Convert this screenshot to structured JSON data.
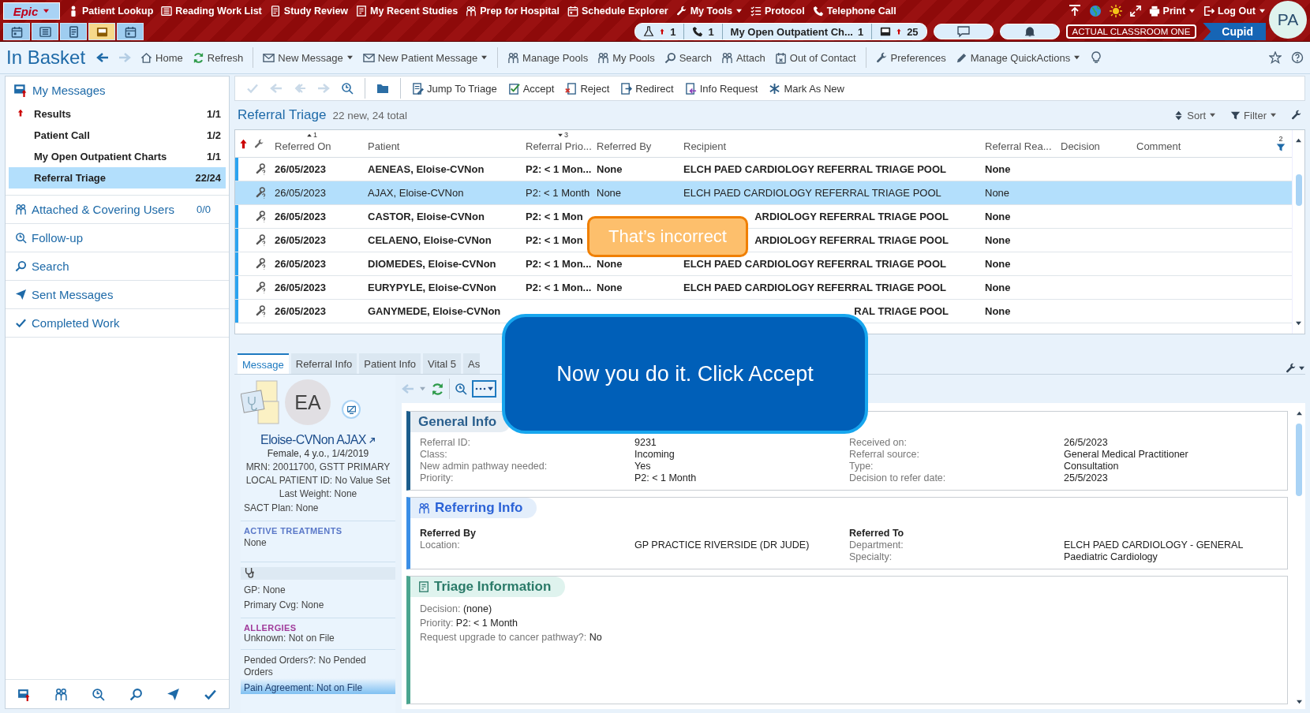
{
  "top_menu": {
    "logo": "Epic",
    "logo_dropdown": true,
    "items": [
      {
        "label": "Patient Lookup",
        "dropdown": false
      },
      {
        "label": "Reading Work List",
        "dropdown": false
      },
      {
        "label": "Study Review",
        "dropdown": false
      },
      {
        "label": "My Recent Studies",
        "dropdown": false
      },
      {
        "label": "Prep for Hospital",
        "dropdown": false
      },
      {
        "label": "Schedule Explorer",
        "dropdown": false
      },
      {
        "label": "My Tools",
        "dropdown": true
      },
      {
        "label": "Protocol",
        "dropdown": false
      },
      {
        "label": "Telephone Call",
        "dropdown": false
      }
    ],
    "right_items": [
      {
        "label": "Print",
        "dropdown": true
      },
      {
        "label": "Log Out",
        "dropdown": true
      }
    ]
  },
  "activity_tabs": [
    {
      "selected": false
    },
    {
      "selected": false
    },
    {
      "selected": false
    },
    {
      "selected": true
    },
    {
      "selected": false
    }
  ],
  "status_pills": [
    {
      "count": "1",
      "alert": true
    },
    {
      "count": "1",
      "alert": false
    },
    {
      "label": "My Open Outpatient Ch...",
      "count": "1",
      "alert": false
    },
    {
      "count": "25",
      "alert": true
    }
  ],
  "environment": "ACTUAL CLASSROOM ONE",
  "user_tag": "Cupid",
  "avatar": "PA",
  "inbasket_toolbar": {
    "title": "In Basket",
    "items": [
      {
        "label": "Home",
        "dropdown": false,
        "group_start": false
      },
      {
        "label": "Refresh",
        "dropdown": false,
        "group_start": false
      },
      {
        "label": "New Message",
        "dropdown": true,
        "group_start": true
      },
      {
        "label": "New Patient Message",
        "dropdown": true,
        "group_start": false
      },
      {
        "label": "Manage Pools",
        "dropdown": false,
        "group_start": true
      },
      {
        "label": "My Pools",
        "dropdown": false,
        "group_start": false
      },
      {
        "label": "Search",
        "dropdown": false,
        "group_start": false
      },
      {
        "label": "Attach",
        "dropdown": false,
        "group_start": false
      },
      {
        "label": "Out of Contact",
        "dropdown": false,
        "group_start": false
      },
      {
        "label": "Preferences",
        "dropdown": false,
        "group_start": true
      },
      {
        "label": "Manage QuickActions",
        "dropdown": true,
        "group_start": false
      }
    ]
  },
  "action_toolbar": {
    "icon_buttons": [
      {
        "disabled": true
      },
      {
        "disabled": true
      },
      {
        "disabled": true
      },
      {
        "disabled": true
      },
      {
        "disabled": false
      },
      {
        "disabled": false
      }
    ],
    "items": [
      {
        "label": "Jump To Triage",
        "disabled": false
      },
      {
        "label": "Accept",
        "disabled": false
      },
      {
        "label": "Reject",
        "disabled": false
      },
      {
        "label": "Redirect",
        "disabled": false
      },
      {
        "label": "Info Request",
        "disabled": false
      },
      {
        "label": "Mark As New",
        "disabled": false
      }
    ]
  },
  "sidebar": {
    "header": "My Messages",
    "folders": [
      {
        "label": "Results",
        "count": "1/1",
        "alert": true,
        "selected": false
      },
      {
        "label": "Patient Call",
        "count": "1/2",
        "alert": false,
        "selected": false
      },
      {
        "label": "My Open Outpatient Charts",
        "count": "1/1",
        "alert": false,
        "selected": false
      },
      {
        "label": "Referral Triage",
        "count": "22/24",
        "alert": false,
        "selected": true
      }
    ],
    "links": [
      {
        "label": "Attached & Covering Users",
        "count": "0/0"
      },
      {
        "label": "Follow-up"
      },
      {
        "label": "Search"
      },
      {
        "label": "Sent Messages"
      },
      {
        "label": "Completed Work"
      }
    ]
  },
  "list": {
    "title": "Referral Triage",
    "summary": "22 new, 24 total",
    "sort": "Sort",
    "filter": "Filter",
    "filter_count": "2",
    "columns": [
      {
        "label": "Referred On",
        "sort_order": "1",
        "sort_descending": false
      },
      {
        "label": "Patient"
      },
      {
        "label": "Referral Prio...",
        "sort_order": "3",
        "sort_descending": true
      },
      {
        "label": "Referred By"
      },
      {
        "label": "Recipient"
      },
      {
        "label": "Referral Rea..."
      },
      {
        "label": "Decision"
      },
      {
        "label": "Comment"
      }
    ],
    "rows": [
      {
        "unread": true,
        "selected": false,
        "referred_on": "26/05/2023",
        "patient": "AENEAS, Eloise-CVNon",
        "priority": "P2: < 1 Mon...",
        "referred_by": "None",
        "recipient": "ELCH PAED CARDIOLOGY REFERRAL TRIAGE POOL",
        "reason": "None"
      },
      {
        "unread": false,
        "selected": true,
        "referred_on": "26/05/2023",
        "patient": "AJAX, Eloise-CVNon",
        "priority": "P2: < 1 Month",
        "referred_by": "None",
        "recipient": "ELCH PAED CARDIOLOGY REFERRAL TRIAGE POOL",
        "reason": "None"
      },
      {
        "unread": true,
        "selected": false,
        "referred_on": "26/05/2023",
        "patient": "CASTOR, Eloise-CVNon",
        "priority": "P2: < 1 Mon",
        "recipient_tail": "ARDIOLOGY REFERRAL TRIAGE POOL",
        "reason": "None"
      },
      {
        "unread": true,
        "selected": false,
        "referred_on": "26/05/2023",
        "patient": "CELAENO, Eloise-CVNon",
        "priority": "P2: < 1 Mon",
        "recipient_tail": "ARDIOLOGY REFERRAL TRIAGE POOL",
        "reason": "None"
      },
      {
        "unread": true,
        "selected": false,
        "referred_on": "26/05/2023",
        "patient": "DIOMEDES, Eloise-CVNon",
        "priority": "P2: < 1 Mon...",
        "referred_by": "None",
        "recipient": "ELCH PAED CARDIOLOGY REFERRAL TRIAGE POOL",
        "reason": "None"
      },
      {
        "unread": true,
        "selected": false,
        "referred_on": "26/05/2023",
        "patient": "EURYPYLE, Eloise-CVNon",
        "priority": "P2: < 1 Mon...",
        "referred_by": "None",
        "recipient": "ELCH PAED CARDIOLOGY REFERRAL TRIAGE POOL",
        "reason": "None"
      },
      {
        "unread": true,
        "selected": false,
        "referred_on": "26/05/2023",
        "patient": "GANYMEDE, Eloise-CVNon",
        "recipient_tail": "RAL TRIAGE POOL",
        "reason": "None"
      }
    ]
  },
  "detail_tabs": [
    {
      "label": "Message",
      "selected": true
    },
    {
      "label": "Referral Info",
      "selected": false
    },
    {
      "label": "Patient Info",
      "selected": false
    },
    {
      "label": "Vital 5",
      "selected": false
    },
    {
      "label": "As",
      "selected": false
    }
  ],
  "patient": {
    "initials": "EA",
    "name": "Eloise-CVNon AJAX",
    "demographics": "Female, 4 y.o., 1/4/2019",
    "ids": [
      "MRN: 20011700, GSTT PRIMARY",
      "LOCAL PATIENT ID: No Value Set"
    ],
    "last_weight": "Last Weight: None",
    "sact": "SACT Plan: None",
    "active_treatments": {
      "heading": "ACTIVE TREATMENTS",
      "value": "None"
    },
    "gp": "GP: None",
    "coverage": "Primary Cvg: None",
    "allergies": {
      "heading": "ALLERGIES",
      "value": "Unknown: Not on File"
    },
    "pended_orders": "Pended Orders?: No Pended Orders",
    "pain_agreement": "Pain Agreement: Not on File"
  },
  "general_info": {
    "title": "General Info",
    "left": [
      {
        "label": "Referral ID:",
        "value": "9231"
      },
      {
        "label": "Class:",
        "value": "Incoming"
      },
      {
        "label": "New admin pathway needed:",
        "value": "Yes"
      },
      {
        "label": "Priority:",
        "value": "P2: < 1 Month"
      }
    ],
    "right": [
      {
        "label": "Received on:",
        "value": "26/5/2023"
      },
      {
        "label": "Referral source:",
        "value": "General Medical Practitioner"
      },
      {
        "label": "Type:",
        "value": "Consultation"
      },
      {
        "label": "Decision to refer date:",
        "value": "25/5/2023"
      }
    ]
  },
  "referring_info": {
    "title": "Referring Info",
    "referred_by": {
      "heading": "Referred By",
      "fields": [
        {
          "label": "Location:",
          "value": "GP PRACTICE RIVERSIDE (DR JUDE)"
        }
      ]
    },
    "referred_to": {
      "heading": "Referred To",
      "fields": [
        {
          "label": "Department:",
          "value": "ELCH PAED CARDIOLOGY - GENERAL"
        },
        {
          "label": "Specialty:",
          "value": "Paediatric Cardiology"
        }
      ]
    }
  },
  "triage_info": {
    "title": "Triage Information",
    "fields": [
      {
        "label": "Decision:",
        "value": "(none)"
      },
      {
        "label": "Priority:",
        "value": "P2: < 1 Month"
      },
      {
        "label": "Request upgrade to cancer pathway?:",
        "value": "No"
      }
    ]
  },
  "coach": {
    "feedback": "That’s incorrect",
    "instruction": "Now you do it. Click Accept"
  }
}
